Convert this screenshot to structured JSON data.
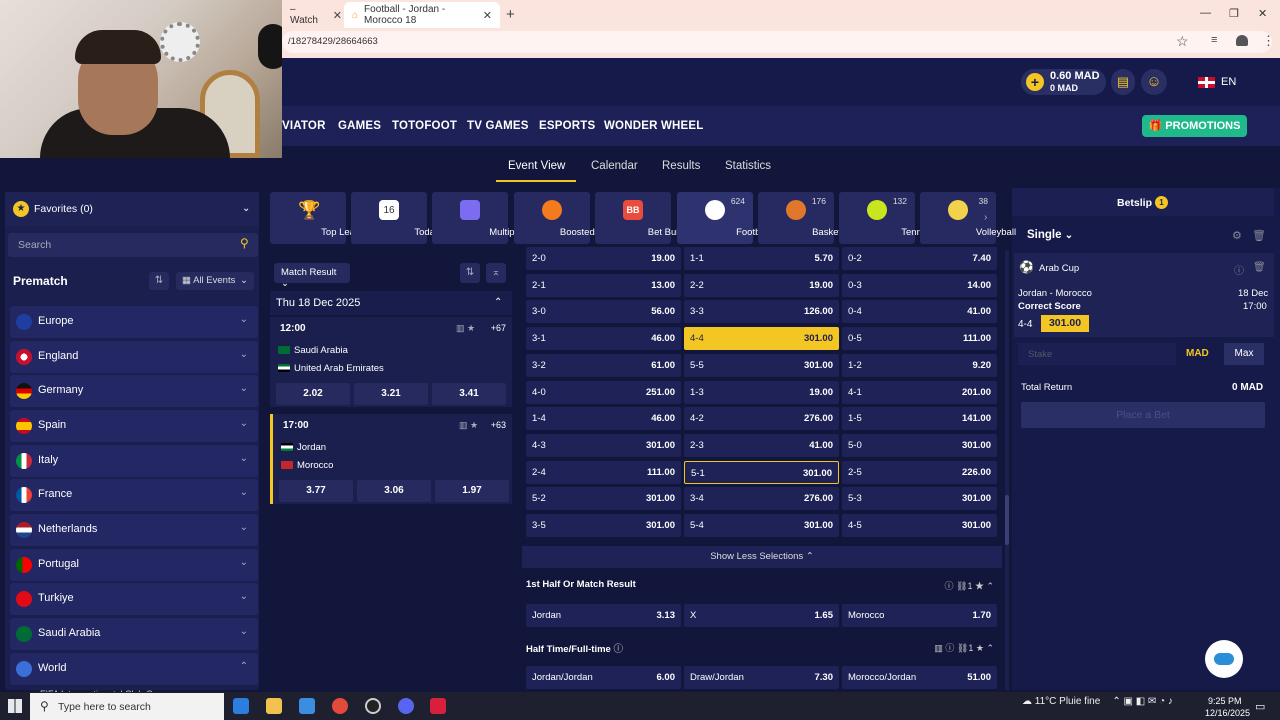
{
  "browser": {
    "tab1_title": "– Watch",
    "tab2_title": "Football - Jordan - Morocco 18",
    "url": "/18278429/28664663"
  },
  "header": {
    "balance_main": "0.60 MAD",
    "balance_bonus": "0 MAD",
    "language": "EN"
  },
  "nav": {
    "items": [
      "VIATOR",
      "GAMES",
      "TOTOFOOT",
      "TV GAMES",
      "ESPORTS",
      "WONDER WHEEL"
    ],
    "promotions": "PROMOTIONS"
  },
  "subnav": {
    "tabs": [
      "Event View",
      "Calendar",
      "Results",
      "Statistics"
    ],
    "active": "Event View"
  },
  "sidebar": {
    "favorites": "Favorites (0)",
    "search_placeholder": "Search",
    "prematch": "Prematch",
    "all_events": "All Events",
    "countries": [
      "Europe",
      "England",
      "Germany",
      "Spain",
      "Italy",
      "France",
      "Netherlands",
      "Portugal",
      "Turkiye",
      "Saudi Arabia",
      "World"
    ],
    "partial_item": "FIFA Intercontinental Club Cup"
  },
  "sports": [
    {
      "label": "Top League",
      "count": ""
    },
    {
      "label": "Today",
      "count": "",
      "icon_text": "16"
    },
    {
      "label": "Multiples",
      "count": ""
    },
    {
      "label": "Boosted Odds",
      "count": ""
    },
    {
      "label": "Bet Builder",
      "count": "",
      "icon_text": "BB"
    },
    {
      "label": "Football",
      "count": "624"
    },
    {
      "label": "Basketball",
      "count": "176"
    },
    {
      "label": "Tennis",
      "count": "132"
    },
    {
      "label": "Volleyball",
      "count": "38"
    }
  ],
  "matchlist": {
    "market_select": "Match Result",
    "date": "Thu 18 Dec 2025",
    "matches": [
      {
        "time": "12:00",
        "more": "+67",
        "home": "Saudi Arabia",
        "away": "United Arab Emirates",
        "odds": [
          "2.02",
          "3.21",
          "3.41"
        ]
      },
      {
        "time": "17:00",
        "more": "+63",
        "home": "Jordan",
        "away": "Morocco",
        "odds": [
          "3.77",
          "3.06",
          "1.97"
        ]
      }
    ]
  },
  "correct_score": {
    "rows": [
      [
        [
          "2-0",
          "19.00"
        ],
        [
          "1-1",
          "5.70"
        ],
        [
          "0-2",
          "7.40"
        ]
      ],
      [
        [
          "2-1",
          "13.00"
        ],
        [
          "2-2",
          "19.00"
        ],
        [
          "0-3",
          "14.00"
        ]
      ],
      [
        [
          "3-0",
          "56.00"
        ],
        [
          "3-3",
          "126.00"
        ],
        [
          "0-4",
          "41.00"
        ]
      ],
      [
        [
          "3-1",
          "46.00"
        ],
        [
          "4-4",
          "301.00"
        ],
        [
          "0-5",
          "111.00"
        ]
      ],
      [
        [
          "3-2",
          "61.00"
        ],
        [
          "5-5",
          "301.00"
        ],
        [
          "1-2",
          "9.20"
        ]
      ],
      [
        [
          "4-0",
          "251.00"
        ],
        [
          "1-3",
          "19.00"
        ],
        [
          "4-1",
          "201.00"
        ]
      ],
      [
        [
          "1-4",
          "46.00"
        ],
        [
          "4-2",
          "276.00"
        ],
        [
          "1-5",
          "141.00"
        ]
      ],
      [
        [
          "4-3",
          "301.00"
        ],
        [
          "2-3",
          "41.00"
        ],
        [
          "5-0",
          "301.00"
        ]
      ],
      [
        [
          "2-4",
          "111.00"
        ],
        [
          "5-1",
          "301.00"
        ],
        [
          "2-5",
          "226.00"
        ]
      ],
      [
        [
          "5-2",
          "301.00"
        ],
        [
          "3-4",
          "276.00"
        ],
        [
          "5-3",
          "301.00"
        ]
      ],
      [
        [
          "3-5",
          "301.00"
        ],
        [
          "5-4",
          "301.00"
        ],
        [
          "4-5",
          "301.00"
        ]
      ]
    ],
    "selected": "4-4",
    "show_less": "Show Less Selections"
  },
  "first_half": {
    "title": "1st Half Or Match Result",
    "count": "1",
    "odds": [
      [
        "Jordan",
        "3.13"
      ],
      [
        "X",
        "1.65"
      ],
      [
        "Morocco",
        "1.70"
      ]
    ]
  },
  "htft": {
    "title": "Half Time/Full-time",
    "count": "1",
    "odds": [
      [
        "Jordan/Jordan",
        "6.00"
      ],
      [
        "Draw/Jordan",
        "7.30"
      ],
      [
        "Morocco/Jordan",
        "51.00"
      ]
    ]
  },
  "betslip": {
    "title": "Betslip",
    "badge": "1",
    "mode": "Single",
    "competition": "Arab Cup",
    "match": "Jordan - Morocco",
    "date": "18 Dec",
    "market": "Correct Score",
    "time": "17:00",
    "selection": "4-4",
    "odd": "301.00",
    "stake_placeholder": "Stake",
    "currency": "MAD",
    "max": "Max",
    "total_return_label": "Total Return",
    "total_return_value": "0 MAD",
    "place_bet": "Place a Bet"
  },
  "taskbar": {
    "search": "Type here to search",
    "weather": "11°C Pluie fine",
    "time": "9:25 PM",
    "date": "12/16/2025"
  },
  "colors": {
    "accent": "#f3c623",
    "promo": "#20b98b",
    "bg": "#12163b"
  }
}
